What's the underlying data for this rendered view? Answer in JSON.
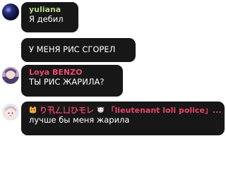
{
  "messages": [
    {
      "author": "yuliana",
      "author_color": "#b6d989",
      "text": "Я дебил",
      "avatar_icon": "dark-sphere-avatar"
    },
    {
      "author": "",
      "text": "У МЕНЯ РИС СГОРЕЛ"
    },
    {
      "author": "Loya BENZO",
      "author_color": "#ee4a6f",
      "text": "ТЫ РИС ЖАРИЛА?",
      "avatar_icon": "anime-portrait-avatar"
    },
    {
      "author": "り卂ㄥㄩひモレ",
      "author_suffix": "「lieutenant loli police」...",
      "author_color": "#e9456a",
      "text": "лучше бы меня жарила",
      "avatar_icon": "chibi-portrait-avatar",
      "name_prefix_icon": "cat-emoji-icon",
      "name_mid_icon": "cow-emoji-icon"
    }
  ]
}
